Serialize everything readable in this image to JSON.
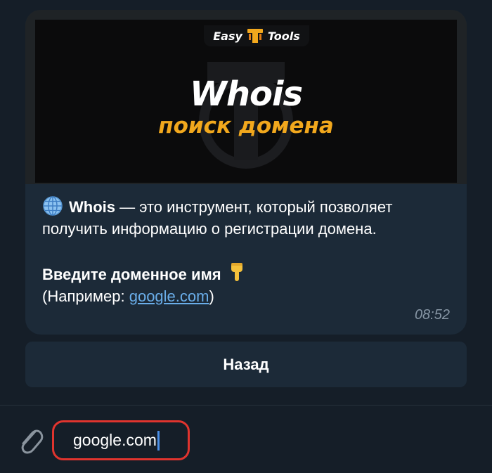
{
  "banner": {
    "brand_left": "Easy",
    "brand_right": "Tools",
    "title": "Whois",
    "subtitle": "поиск домена",
    "accent_color": "#f2a81d"
  },
  "message": {
    "intro_bold": "Whois",
    "intro_rest": " — это инструмент, который позволяет получить информацию о регистрации домена.",
    "prompt": "Введите доменное имя",
    "example_prefix": "(Например: ",
    "example_link": "google.com",
    "example_suffix": ")",
    "time": "08:52",
    "icons": [
      "globe-icon",
      "pointing-down-icon"
    ]
  },
  "buttons": {
    "back_label": "Назад"
  },
  "input": {
    "value": "google.com",
    "attach_icon": "paperclip-icon"
  }
}
